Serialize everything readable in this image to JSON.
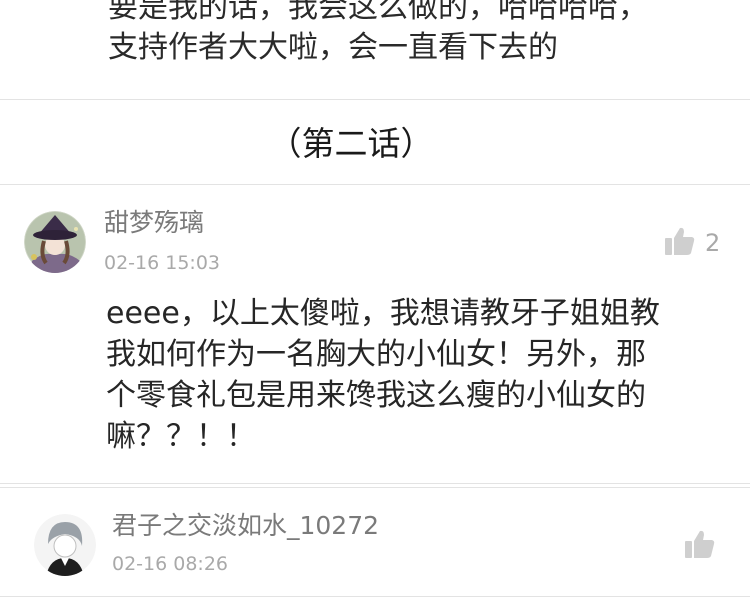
{
  "previous_comment": {
    "lines": [
      "要是我的话，我会这么做的，哈哈哈哈，",
      "支持作者大大啦，会一直看下去的"
    ]
  },
  "chapter_header": {
    "title": "（第二话）"
  },
  "comments": [
    {
      "username": "甜梦殇璃",
      "time": "02-16 15:03",
      "likes": "2",
      "body_lines": [
        "eeee，以上太傻啦，我想请教牙子姐姐教",
        "我如何作为一名胸大的小仙女！另外，那",
        "个零食礼包是用来馋我这么瘦的小仙女的",
        "嘛？？！！"
      ]
    },
    {
      "username": "君子之交淡如水_10272",
      "time": "02-16 08:26",
      "likes": ""
    }
  ],
  "icons": {
    "like": "thumbs-up-icon",
    "avatar": "avatar"
  },
  "colors": {
    "username": "#7a7a7a",
    "time": "#a9a9a9",
    "like_icon": "#cfcfcf",
    "divider": "#e3e3e3"
  }
}
